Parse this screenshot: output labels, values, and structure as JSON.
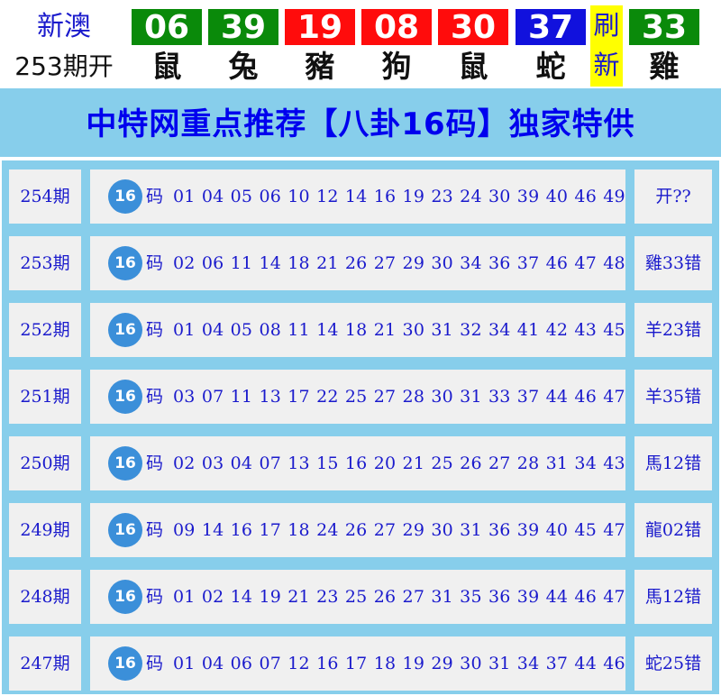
{
  "header": {
    "region": "新澳",
    "issue": "253期开",
    "refresh_label": "刷新",
    "balls": [
      {
        "number": "06",
        "zodiac": "鼠",
        "color": "green"
      },
      {
        "number": "39",
        "zodiac": "兔",
        "color": "green"
      },
      {
        "number": "19",
        "zodiac": "豬",
        "color": "red"
      },
      {
        "number": "08",
        "zodiac": "狗",
        "color": "red"
      },
      {
        "number": "30",
        "zodiac": "鼠",
        "color": "red"
      },
      {
        "number": "37",
        "zodiac": "蛇",
        "color": "blue"
      },
      {
        "number": "33",
        "zodiac": "雞",
        "color": "green"
      }
    ]
  },
  "banner": {
    "title": "中特网重点推荐【八卦16码】独家特供"
  },
  "colors": {
    "green": "#0a8a0a",
    "red": "#ff0c0c",
    "blue": "#1111dd",
    "banner_bg": "#87ceeb",
    "title_text": "#0000ee",
    "cell_bg": "#f0f0f0",
    "badge_bg": "#3b8fd9",
    "refresh_bg": "#ffff00"
  },
  "rows": [
    {
      "period": "254期",
      "badge": "16",
      "unit": "码",
      "numbers": "01 04 05 06 10 12 14 16 19 23 24 30 39 40 46 49",
      "result": "开??"
    },
    {
      "period": "253期",
      "badge": "16",
      "unit": "码",
      "numbers": "02 06 11 14 18 21 26 27 29 30 34 36 37 46 47 48",
      "result": "雞33错"
    },
    {
      "period": "252期",
      "badge": "16",
      "unit": "码",
      "numbers": "01 04 05 08 11 14 18 21 30 31 32 34 41 42 43 45",
      "result": "羊23错"
    },
    {
      "period": "251期",
      "badge": "16",
      "unit": "码",
      "numbers": "03 07 11 13 17 22 25 27 28 30 31 33 37 44 46 47",
      "result": "羊35错"
    },
    {
      "period": "250期",
      "badge": "16",
      "unit": "码",
      "numbers": "02 03 04 07 13 15 16 20 21 25 26 27 28 31 34 43",
      "result": "馬12错"
    },
    {
      "period": "249期",
      "badge": "16",
      "unit": "码",
      "numbers": "09 14 16 17 18 24 26 27 29 30 31 36 39 40 45 47",
      "result": "龍02错"
    },
    {
      "period": "248期",
      "badge": "16",
      "unit": "码",
      "numbers": "01 02 14 19 21 23 25 26 27 31 35 36 39 44 46 47",
      "result": "馬12错"
    },
    {
      "period": "247期",
      "badge": "16",
      "unit": "码",
      "numbers": "01 04 06 07 12 16 17 18 19 29 30 31 34 37 44 46",
      "result": "蛇25错"
    }
  ]
}
